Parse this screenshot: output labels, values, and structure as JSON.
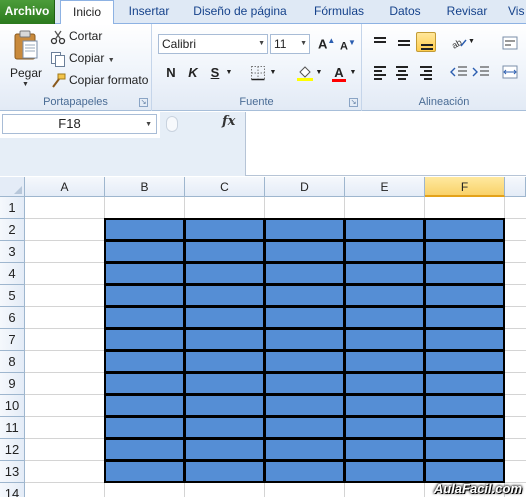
{
  "tabs": [
    "Archivo",
    "Inicio",
    "Insertar",
    "Diseño de página",
    "Fórmulas",
    "Datos",
    "Revisar",
    "Vis"
  ],
  "ribbon": {
    "portapapeles": {
      "pegar": "Pegar",
      "cortar": "Cortar",
      "copiar": "Copiar",
      "copiar_formato": "Copiar formato",
      "label": "Portapapeles"
    },
    "fuente": {
      "font_name": "Calibri",
      "font_size": "11",
      "bold": "N",
      "italic": "K",
      "underline": "S",
      "grow": "A",
      "shrink": "A",
      "font_color_letter": "A",
      "label": "Fuente",
      "fill_color": "#ffff00",
      "font_color": "#ff0000"
    },
    "alineacion": {
      "label": "Alineación"
    }
  },
  "formula_bar": {
    "name_box": "F18",
    "fx": "fx",
    "value": ""
  },
  "sheet": {
    "columns": [
      "A",
      "B",
      "C",
      "D",
      "E",
      "F"
    ],
    "selected_column": "F",
    "rows": [
      "1",
      "2",
      "3",
      "4",
      "5",
      "6",
      "7",
      "8",
      "9",
      "10",
      "11",
      "12",
      "13",
      "14"
    ],
    "fill_color": "#558ed5",
    "filled_range": "B2:F13"
  },
  "watermark": "AulaFacil.com"
}
